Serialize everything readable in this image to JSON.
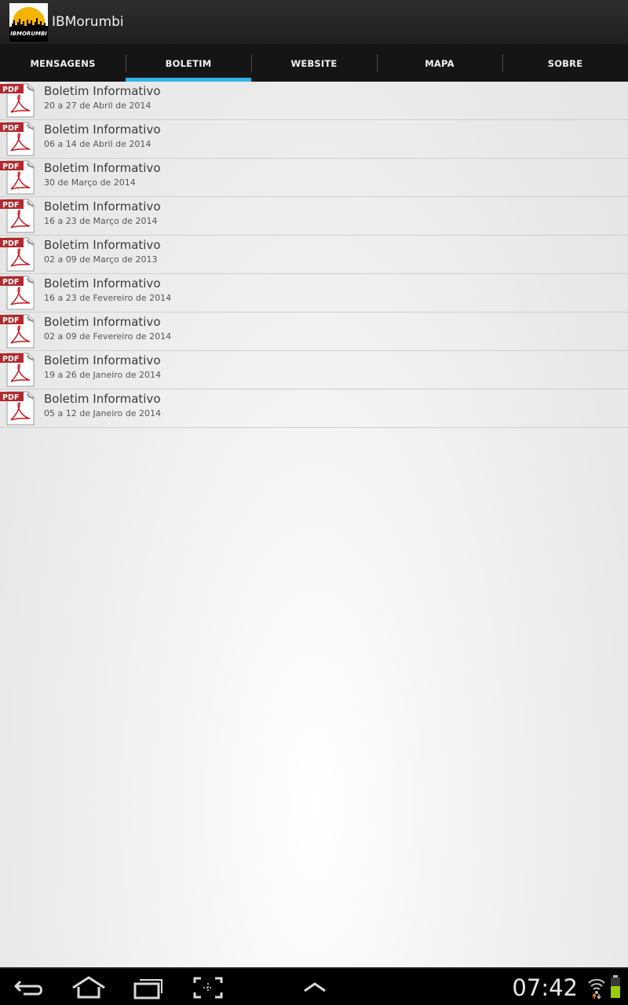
{
  "app": {
    "title": "IBMorumbi",
    "logo_text": "IBMORUMBI"
  },
  "tabs": [
    {
      "label": "MENSAGENS",
      "selected": false
    },
    {
      "label": "BOLETIM",
      "selected": true
    },
    {
      "label": "WEBSITE",
      "selected": false
    },
    {
      "label": "MAPA",
      "selected": false
    },
    {
      "label": "SOBRE",
      "selected": false
    }
  ],
  "boletins": [
    {
      "title": "Boletim Informativo",
      "date": "20 a 27 de Abril de 2014",
      "icon": "pdf-icon",
      "icon_label": "PDF"
    },
    {
      "title": "Boletim Informativo",
      "date": "06 a 14 de Abril de 2014",
      "icon": "pdf-icon",
      "icon_label": "PDF"
    },
    {
      "title": "Boletim Informativo",
      "date": "30 de Março de 2014",
      "icon": "pdf-icon",
      "icon_label": "PDF"
    },
    {
      "title": "Boletim Informativo",
      "date": "16 a 23 de Março de 2014",
      "icon": "pdf-icon",
      "icon_label": "PDF"
    },
    {
      "title": "Boletim Informativo",
      "date": "02 a 09 de Março de 2013",
      "icon": "pdf-icon",
      "icon_label": "PDF"
    },
    {
      "title": "Boletim Informativo",
      "date": "16 a 23 de Fevereiro de 2014",
      "icon": "pdf-icon",
      "icon_label": "PDF"
    },
    {
      "title": "Boletim Informativo",
      "date": "02 a 09 de Fevereiro de 2014",
      "icon": "pdf-icon",
      "icon_label": "PDF"
    },
    {
      "title": "Boletim Informativo",
      "date": "19 a 26 de Janeiro de 2014",
      "icon": "pdf-icon",
      "icon_label": "PDF"
    },
    {
      "title": "Boletim Informativo",
      "date": "05 a 12 de Janeiro de 2014",
      "icon": "pdf-icon",
      "icon_label": "PDF"
    }
  ],
  "system_bar": {
    "clock": "07:42",
    "buttons": [
      "back-icon",
      "home-icon",
      "recent-apps-icon",
      "screenshot-icon",
      "menu-up-icon"
    ],
    "status_icons": [
      "wifi-icon",
      "battery-icon"
    ]
  },
  "colors": {
    "accent": "#33b5e5",
    "pdf_red": "#b3282d",
    "battery_green": "#99cc00"
  }
}
